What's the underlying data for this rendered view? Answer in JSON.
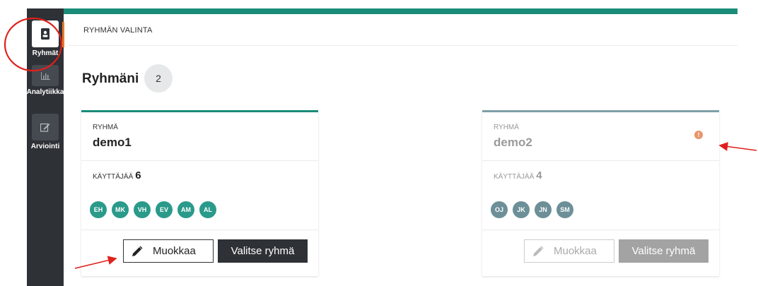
{
  "sidebar": {
    "items": [
      {
        "label": "Ryhmät",
        "icon": "contact-book-icon"
      },
      {
        "label": "Analytiikka",
        "icon": "bar-chart-icon"
      },
      {
        "label": "Arviointi",
        "icon": "edit-icon"
      }
    ]
  },
  "header": {
    "breadcrumb": "RYHMÄN VALINTA"
  },
  "main": {
    "title": "Ryhmäni",
    "group_count": "2",
    "groups": [
      {
        "section_label": "RYHMÄ",
        "name": "demo1",
        "users_label": "KÄYTTÄJÄÄ",
        "users_count": "6",
        "members": [
          "EH",
          "MK",
          "VH",
          "EV",
          "AM",
          "AL"
        ],
        "edit_label": "Muokkaa",
        "select_label": "Valitse ryhmä",
        "accent": "#1a8c78"
      },
      {
        "section_label": "RYHMÄ",
        "name": "demo2",
        "users_label": "KÄYTTÄJÄÄ",
        "users_count": "4",
        "members": [
          "OJ",
          "JK",
          "JN",
          "SM"
        ],
        "edit_label": "Muokkaa",
        "select_label": "Valitse ryhmä",
        "warning": "!",
        "accent": "#7e9fa7"
      }
    ]
  },
  "colors": {
    "brand": "#1a8c78",
    "sidebar": "#2e3136",
    "annotation": "#e0201c"
  }
}
